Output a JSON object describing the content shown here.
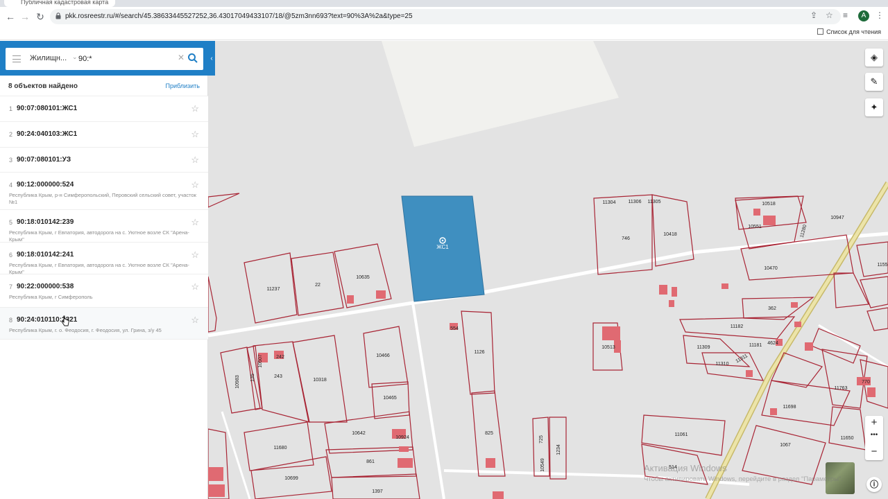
{
  "browser": {
    "tab_title": "Публичная кадастровая карта",
    "url": "pkk.rosreestr.ru/#/search/45.38633445527252,36.43017049433107/18/@5zm3nn693?text=90%3A%2a&type=25",
    "reading_list": "Список для чтения",
    "avatar_letter": "A"
  },
  "search": {
    "type_label": "Жилищн...",
    "query": "90:*"
  },
  "results": {
    "count_label": "8 объектов найдено",
    "zoom_label": "Приблизить",
    "items": [
      {
        "num": "1",
        "title": "90:07:080101:ЖС1",
        "sub": ""
      },
      {
        "num": "2",
        "title": "90:24:040103:ЖС1",
        "sub": ""
      },
      {
        "num": "3",
        "title": "90:07:080101:УЗ",
        "sub": ""
      },
      {
        "num": "4",
        "title": "90:12:000000:524",
        "sub": "Республика Крым, р-н Симферопольский, Перовский сельский совет, участок №1"
      },
      {
        "num": "5",
        "title": "90:18:010142:239",
        "sub": "Республика Крым, г Евпатория, автодорога на с. Уютное возле СК \"Арена-Крым\""
      },
      {
        "num": "6",
        "title": "90:18:010142:241",
        "sub": "Республика Крым, г Евпатория, автодорога на с. Уютное возле СК \"Арена-Крым\""
      },
      {
        "num": "7",
        "title": "90:22:000000:538",
        "sub": "Республика Крым, г Симферополь"
      },
      {
        "num": "8",
        "title": "90:24:010110:2321",
        "sub": "Республика Крым, г. о. Феодосия, г. Феодосия, ул. Грина, з/у 45"
      }
    ]
  },
  "map": {
    "selected_label": "ЖС1",
    "parcel_labels": [
      "11304",
      "11306",
      "11305",
      "746",
      "10418",
      "10518",
      "10551",
      "11280",
      "10947",
      "10470",
      "1155",
      "362",
      "11237",
      "22",
      "10635",
      "1126",
      "10513",
      "11182",
      "11309",
      "11181",
      "11310",
      "11311",
      "10466",
      "10318",
      "243",
      "10465",
      "10642",
      "10924",
      "861",
      "11680",
      "10699",
      "1397",
      "825",
      "725",
      "1234",
      "11061",
      "11698",
      "11763",
      "11650",
      "1067",
      "514",
      "770",
      "10549",
      "10983",
      "135",
      "242",
      "10507",
      "554",
      "4624"
    ],
    "watermark_title": "Активация Windows",
    "watermark_text": "Чтобы активировать Windows, перейдите в раздел \"Параметры\"."
  },
  "colors": {
    "accent": "#1f7fc6",
    "selected_parcel": "#3f8fc0",
    "parcel_border": "#a82434",
    "building": "#e06a72",
    "highway": "#e8dd9e"
  },
  "icons": [
    "back-arrow-icon",
    "forward-arrow-icon",
    "reload-icon",
    "lock-icon",
    "share-icon",
    "star-icon",
    "reading-list-icon",
    "menu-icon",
    "chevron-down-icon",
    "clear-icon",
    "search-icon",
    "collapse-icon",
    "layers-icon",
    "ruler-icon",
    "locate-icon",
    "zoom-in-icon",
    "zoom-out-icon",
    "info-icon"
  ]
}
